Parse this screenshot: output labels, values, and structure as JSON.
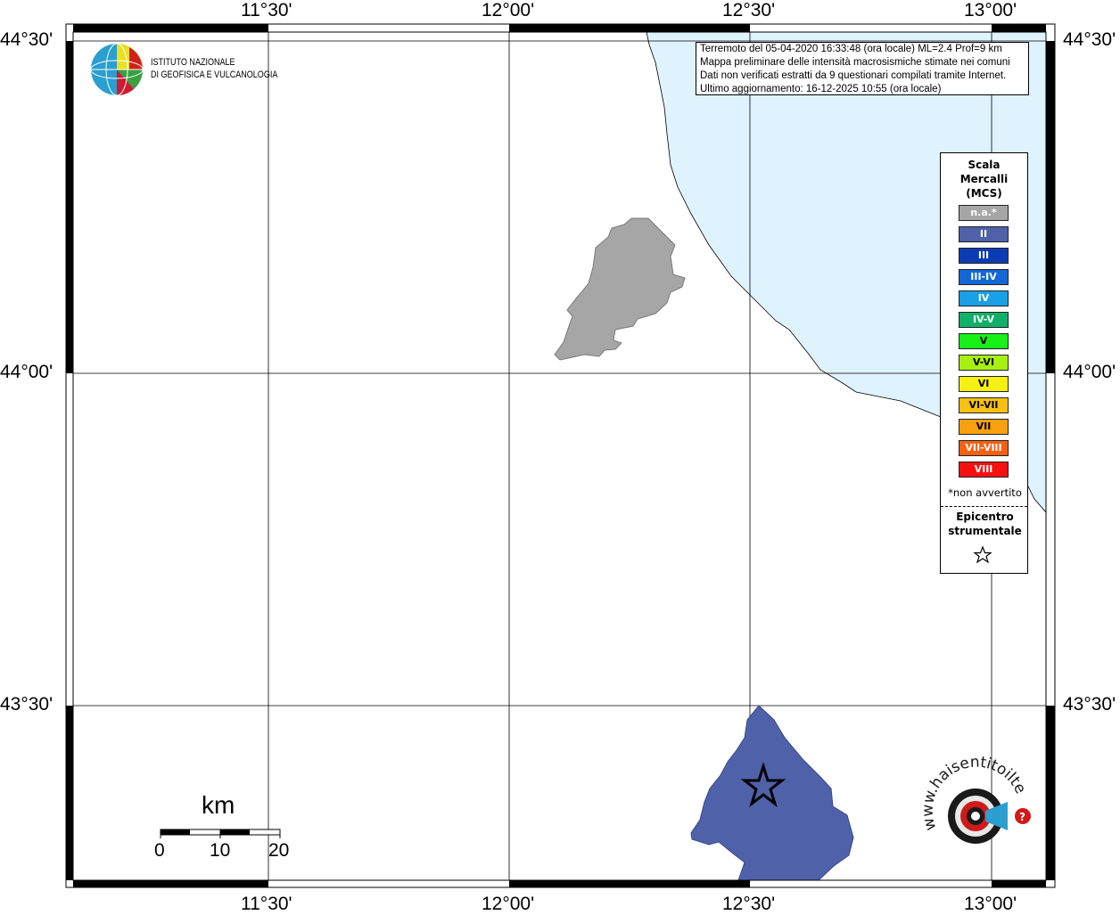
{
  "map": {
    "lon_labels": [
      "11°30'",
      "12°00'",
      "12°30'",
      "13°00'"
    ],
    "lat_labels": [
      "44°30'",
      "44°00'",
      "43°30'"
    ],
    "institute_logo": {
      "line1": "ISTITUTO NAZIONALE",
      "line2": "DI GEOFISICA E VULCANOLOGIA"
    },
    "info": {
      "line1": "Terremoto del 05-04-2020 16:33:48 (ora locale) ML=2.4 Prof=9 km",
      "line2": "Mappa preliminare delle intensità macrosismiche stimate nei comuni",
      "line3": "Dati non verificati estratti da 9 questionari compilati tramite Internet.",
      "line4": "Ultimo aggiornamento: 16-12-2025 10:55 (ora locale)"
    },
    "legend": {
      "title_line1": "Scala",
      "title_line2": "Mercalli",
      "title_line3": "(MCS)",
      "items": [
        {
          "label": "n.a.*",
          "color": "#a6a6a6"
        },
        {
          "label": "II",
          "color": "#4f62a9"
        },
        {
          "label": "III",
          "color": "#0a3cb4"
        },
        {
          "label": "III-IV",
          "color": "#1468d6"
        },
        {
          "label": "IV",
          "color": "#1aa0e6"
        },
        {
          "label": "IV-V",
          "color": "#10b068"
        },
        {
          "label": "V",
          "color": "#18f018"
        },
        {
          "label": "V-VI",
          "color": "#a8f010"
        },
        {
          "label": "VI",
          "color": "#f8f010"
        },
        {
          "label": "VI-VII",
          "color": "#f8c010"
        },
        {
          "label": "VII",
          "color": "#f8a010"
        },
        {
          "label": "VII-VIII",
          "color": "#f86010"
        },
        {
          "label": "VIII",
          "color": "#f81010"
        }
      ],
      "note": "*non avvertito",
      "epicenter_line1": "Epicentro",
      "epicenter_line2": "strumentale"
    },
    "scale": {
      "unit": "km",
      "labels": [
        "0",
        "10",
        "20"
      ]
    },
    "colors": {
      "sea": "#dff3fe",
      "intensity_na": "#a6a6a6",
      "intensity_ii": "#4f62a9"
    },
    "icons": [
      "ingv-globe-logo",
      "epicenter-star-icon",
      "haisentito-logo"
    ],
    "haisentito_logo": "www.haisentitoilterremoto.it"
  }
}
